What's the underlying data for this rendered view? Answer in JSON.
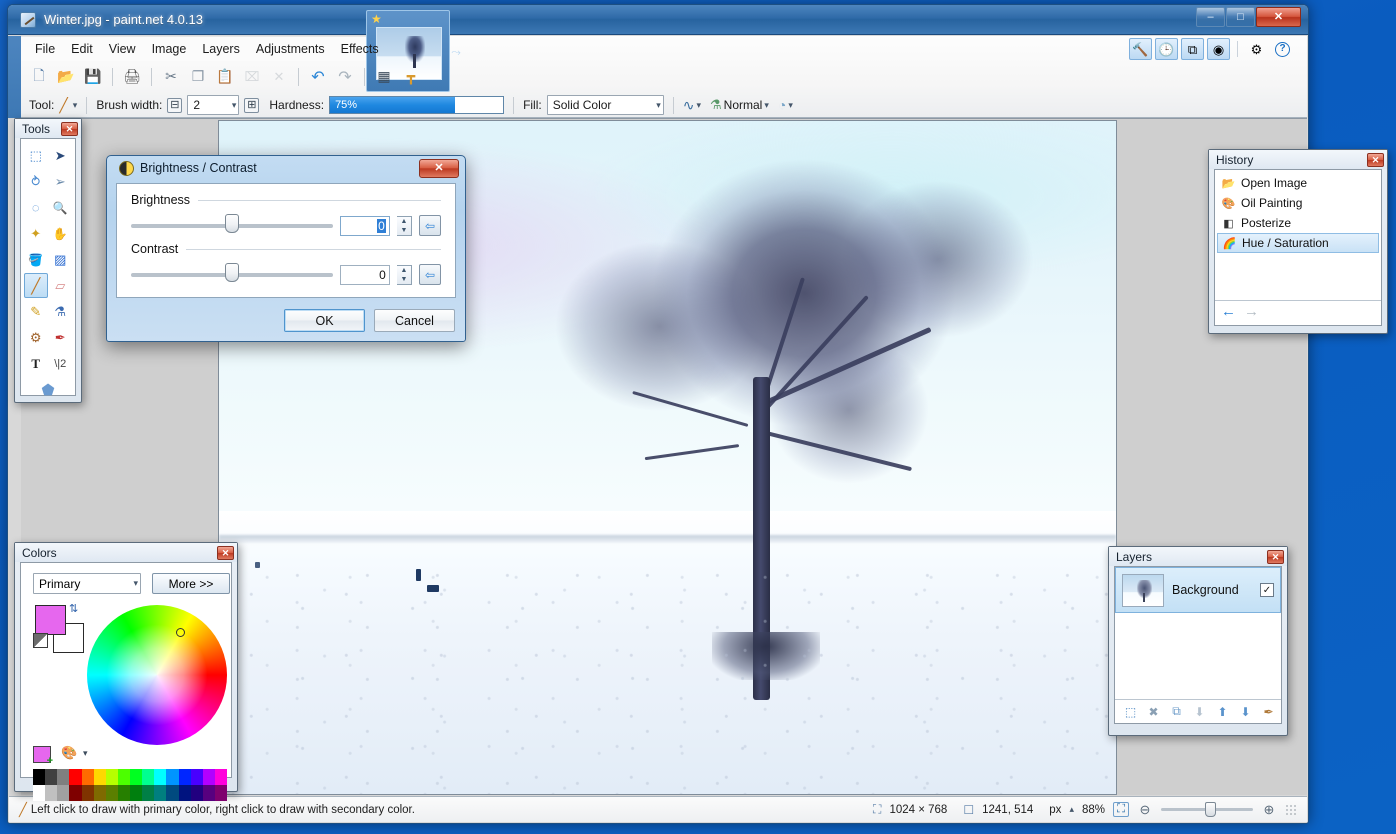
{
  "window": {
    "title": "Winter.jpg - paint.net 4.0.13",
    "app_icon": "paintnet-icon",
    "minimize": "–",
    "maximize": "□",
    "close": "✕"
  },
  "menu": {
    "items": [
      {
        "label": "File"
      },
      {
        "label": "Edit"
      },
      {
        "label": "View"
      },
      {
        "label": "Image"
      },
      {
        "label": "Layers"
      },
      {
        "label": "Adjustments"
      },
      {
        "label": "Effects"
      }
    ]
  },
  "toolbar": {
    "buttons": [
      {
        "name": "new-image-button",
        "glyph": "🗋",
        "label": "New",
        "disabled": false
      },
      {
        "name": "open-image-button",
        "glyph": "📂",
        "label": "Open",
        "disabled": false
      },
      {
        "name": "save-image-button",
        "glyph": "💾",
        "label": "Save",
        "disabled": false
      },
      {
        "name": "print-button",
        "glyph": "🖨",
        "label": "Print",
        "disabled": false
      },
      {
        "name": "cut-button",
        "glyph": "✂",
        "label": "Cut",
        "disabled": false
      },
      {
        "name": "copy-button",
        "glyph": "❐",
        "label": "Copy",
        "disabled": false
      },
      {
        "name": "paste-button",
        "glyph": "📋",
        "label": "Paste",
        "disabled": false
      },
      {
        "name": "crop-to-selection-button",
        "glyph": "⌧",
        "label": "Crop to Selection",
        "disabled": true
      },
      {
        "name": "deselect-all-button",
        "glyph": "✕",
        "label": "Deselect All",
        "disabled": true
      },
      {
        "name": "undo-button",
        "glyph": "↶",
        "label": "Undo",
        "disabled": false
      },
      {
        "name": "redo-button",
        "glyph": "↷",
        "label": "Redo",
        "disabled": false
      },
      {
        "name": "grid-button",
        "glyph": "▦",
        "label": "Grid",
        "disabled": false
      },
      {
        "name": "rulers-button",
        "glyph": "┳",
        "label": "Rulers",
        "disabled": false
      }
    ]
  },
  "tool_options": {
    "tool_label": "Tool:",
    "tool_glyph": "╱",
    "brush_width_label": "Brush width:",
    "brush_width_value": "2",
    "decrease_glyph": "⊟",
    "increase_glyph": "⊞",
    "hardness_label": "Hardness:",
    "hardness_value": "75%",
    "hardness_percent": 72,
    "fill_label": "Fill:",
    "fill_value": "Solid Color",
    "antialias_glyph": "∿",
    "blend_icon": "⚗",
    "blend_value": "Normal",
    "alpha_glyph": "◔",
    "caret": "▾"
  },
  "palette_toggles": [
    {
      "name": "toggle-tools-window",
      "glyph": "🔨",
      "active": true
    },
    {
      "name": "toggle-history-window",
      "glyph": "🕒",
      "active": true
    },
    {
      "name": "toggle-layers-window",
      "glyph": "⧉",
      "active": true
    },
    {
      "name": "toggle-colors-window",
      "glyph": "◉",
      "active": true
    },
    {
      "name": "settings-button",
      "glyph": "⚙",
      "active": false
    },
    {
      "name": "help-button",
      "glyph": "?",
      "active": false
    }
  ],
  "tools_palette": {
    "title": "Tools",
    "close": "✕",
    "tools": [
      {
        "name": "rectangle-select-tool",
        "glyph": "⬚",
        "selected": false
      },
      {
        "name": "move-selected-tool",
        "glyph": "➤",
        "selected": false
      },
      {
        "name": "lasso-select-tool",
        "glyph": "⥁",
        "selected": false
      },
      {
        "name": "move-selection-tool",
        "glyph": "➢",
        "selected": false
      },
      {
        "name": "ellipse-select-tool",
        "glyph": "◌",
        "selected": false
      },
      {
        "name": "zoom-tool",
        "glyph": "🔍",
        "selected": false
      },
      {
        "name": "magic-wand-tool",
        "glyph": "✦",
        "selected": false
      },
      {
        "name": "pan-tool",
        "glyph": "✋",
        "selected": false
      },
      {
        "name": "paint-bucket-tool",
        "glyph": "🪣",
        "selected": false
      },
      {
        "name": "gradient-tool",
        "glyph": "▨",
        "selected": false
      },
      {
        "name": "paintbrush-tool",
        "glyph": "╱",
        "selected": true
      },
      {
        "name": "eraser-tool",
        "glyph": "▱",
        "selected": false
      },
      {
        "name": "pencil-tool",
        "glyph": "✎",
        "selected": false
      },
      {
        "name": "color-picker-tool",
        "glyph": "⚗",
        "selected": false
      },
      {
        "name": "clone-stamp-tool",
        "glyph": "⚙",
        "selected": false
      },
      {
        "name": "recolor-tool",
        "glyph": "✒",
        "selected": false
      },
      {
        "name": "text-tool",
        "glyph": "T",
        "selected": false
      },
      {
        "name": "line-curve-tool",
        "glyph": "\\|2",
        "selected": false
      },
      {
        "name": "shapes-tool",
        "glyph": "⬟",
        "selected": false
      }
    ]
  },
  "colors_palette": {
    "title": "Colors",
    "close": "✕",
    "mode_value": "Primary",
    "mode_caret": "▾",
    "more_label": "More >>",
    "primary_color": "#e667ee",
    "secondary_color": "#ffffff",
    "swap_glyph": "⇅",
    "add_swatch_glyph": "",
    "palette_menu_glyph": "🎨",
    "palette_caret": "▾",
    "palette_row1": [
      "#000000",
      "#404040",
      "#7f7f7f",
      "#ff0000",
      "#ff6a00",
      "#ffd800",
      "#b6ff00",
      "#4cff00",
      "#00ff21",
      "#00ff90",
      "#00ffff",
      "#0094ff",
      "#0026ff",
      "#4800ff",
      "#b200ff",
      "#ff00dc"
    ],
    "palette_row2": [
      "#ffffff",
      "#c0c0c0",
      "#a0a0a0",
      "#7f0000",
      "#7f3300",
      "#7f6a00",
      "#5b7f00",
      "#267f00",
      "#007f0e",
      "#007f46",
      "#007f7f",
      "#004a7f",
      "#00137f",
      "#21007f",
      "#57007f",
      "#7f006e"
    ]
  },
  "history_palette": {
    "title": "History",
    "close": "✕",
    "items": [
      {
        "label": "Open Image",
        "icon": "open-image-icon",
        "glyph": "📂",
        "selected": false
      },
      {
        "label": "Oil Painting",
        "icon": "oil-painting-icon",
        "glyph": "🎨",
        "selected": false
      },
      {
        "label": "Posterize",
        "icon": "posterize-icon",
        "glyph": "◧",
        "selected": false
      },
      {
        "label": "Hue / Saturation",
        "icon": "hue-saturation-icon",
        "glyph": "🌈",
        "selected": true
      }
    ],
    "undo_glyph": "←",
    "redo_glyph": "→"
  },
  "layers_palette": {
    "title": "Layers",
    "close": "✕",
    "layers": [
      {
        "name": "Background",
        "visible": true,
        "check_glyph": "✓",
        "selected": true
      }
    ],
    "footer_buttons": [
      {
        "name": "add-new-layer-button",
        "glyph": "⬚",
        "dim": false
      },
      {
        "name": "delete-layer-button",
        "glyph": "✖",
        "dim": false
      },
      {
        "name": "duplicate-layer-button",
        "glyph": "⧉",
        "dim": false
      },
      {
        "name": "merge-layer-down-button",
        "glyph": "⬇",
        "dim": true
      },
      {
        "name": "move-layer-up-button",
        "glyph": "⬆",
        "dim": false
      },
      {
        "name": "move-layer-down-button",
        "glyph": "⬇",
        "dim": false
      },
      {
        "name": "layer-properties-button",
        "glyph": "✒",
        "dim": false
      }
    ]
  },
  "dialog": {
    "title": "Brightness / Contrast",
    "icon": "brightness-contrast-icon",
    "close": "✕",
    "brightness": {
      "label": "Brightness",
      "value": "0",
      "slider_percent": 50,
      "reset_glyph": "⇦",
      "up_glyph": "▲",
      "down_glyph": "▼"
    },
    "contrast": {
      "label": "Contrast",
      "value": "0",
      "slider_percent": 50,
      "reset_glyph": "⇦",
      "up_glyph": "▲",
      "down_glyph": "▼"
    },
    "ok_label": "OK",
    "cancel_label": "Cancel"
  },
  "document_tab": {
    "title": "Winter.jpg",
    "star_glyph": "★",
    "chevron_glyph": "⤳"
  },
  "statusbar": {
    "hint": "Left click to draw with primary color, right click to draw with secondary color.",
    "hint_icon": "paintbrush-icon",
    "image_size_icon": "image-size-icon",
    "image_size": "1024 × 768",
    "cursor_icon": "cursor-position-icon",
    "cursor_position": "1241, 514",
    "units": "px",
    "units_caret": "▴",
    "zoom_level": "88%",
    "fit_glyph": "⛶",
    "zoom_out_glyph": "⊖",
    "zoom_in_glyph": "⊕",
    "zoom_slider_percent": 48
  }
}
